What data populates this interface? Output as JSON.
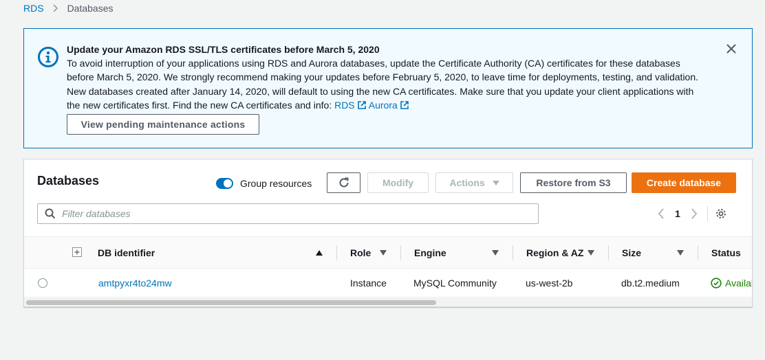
{
  "breadcrumb": {
    "items": [
      "RDS",
      "Databases"
    ]
  },
  "banner": {
    "title": "Update your Amazon RDS SSL/TLS certificates before March 5, 2020",
    "lines": [
      "To avoid interruption of your applications using RDS and Aurora databases, update the Certificate Authority (CA) certificates for these databases",
      "before March 5, 2020. We strongly recommend making your updates before February 5, 2020, to leave time for deployments, testing, and validation.",
      "New databases created after January 14, 2020, will default to using the new CA certificates. Make sure that you update your client applications with"
    ],
    "last_line_prefix": "the new certificates first. Find the new CA certificates and info: ",
    "link_rds": "RDS",
    "link_aurora": "Aurora",
    "button_label": "View pending maintenance actions",
    "icons": {
      "info": "info-icon",
      "close": "close-icon",
      "external": "external-link-icon"
    }
  },
  "panel": {
    "title": "Databases",
    "toggle_label": "Group resources",
    "toggle_on": true,
    "buttons": {
      "modify": "Modify",
      "actions": "Actions",
      "restore": "Restore from S3",
      "create": "Create database"
    },
    "filter_placeholder": "Filter databases",
    "page": "1"
  },
  "table": {
    "columns": [
      "DB identifier",
      "Role",
      "Engine",
      "Region & AZ",
      "Size",
      "Status"
    ],
    "rows": [
      {
        "db_identifier": "amtpyxr4to24mw",
        "role": "Instance",
        "engine": "MySQL Community",
        "region": "us-west-2b",
        "size": "db.t2.medium",
        "status": "Available"
      }
    ]
  },
  "colors": {
    "link": "#0073bb",
    "primary": "#ec7211",
    "banner_bg": "#f1faff",
    "status_ok": "#1d8102"
  }
}
